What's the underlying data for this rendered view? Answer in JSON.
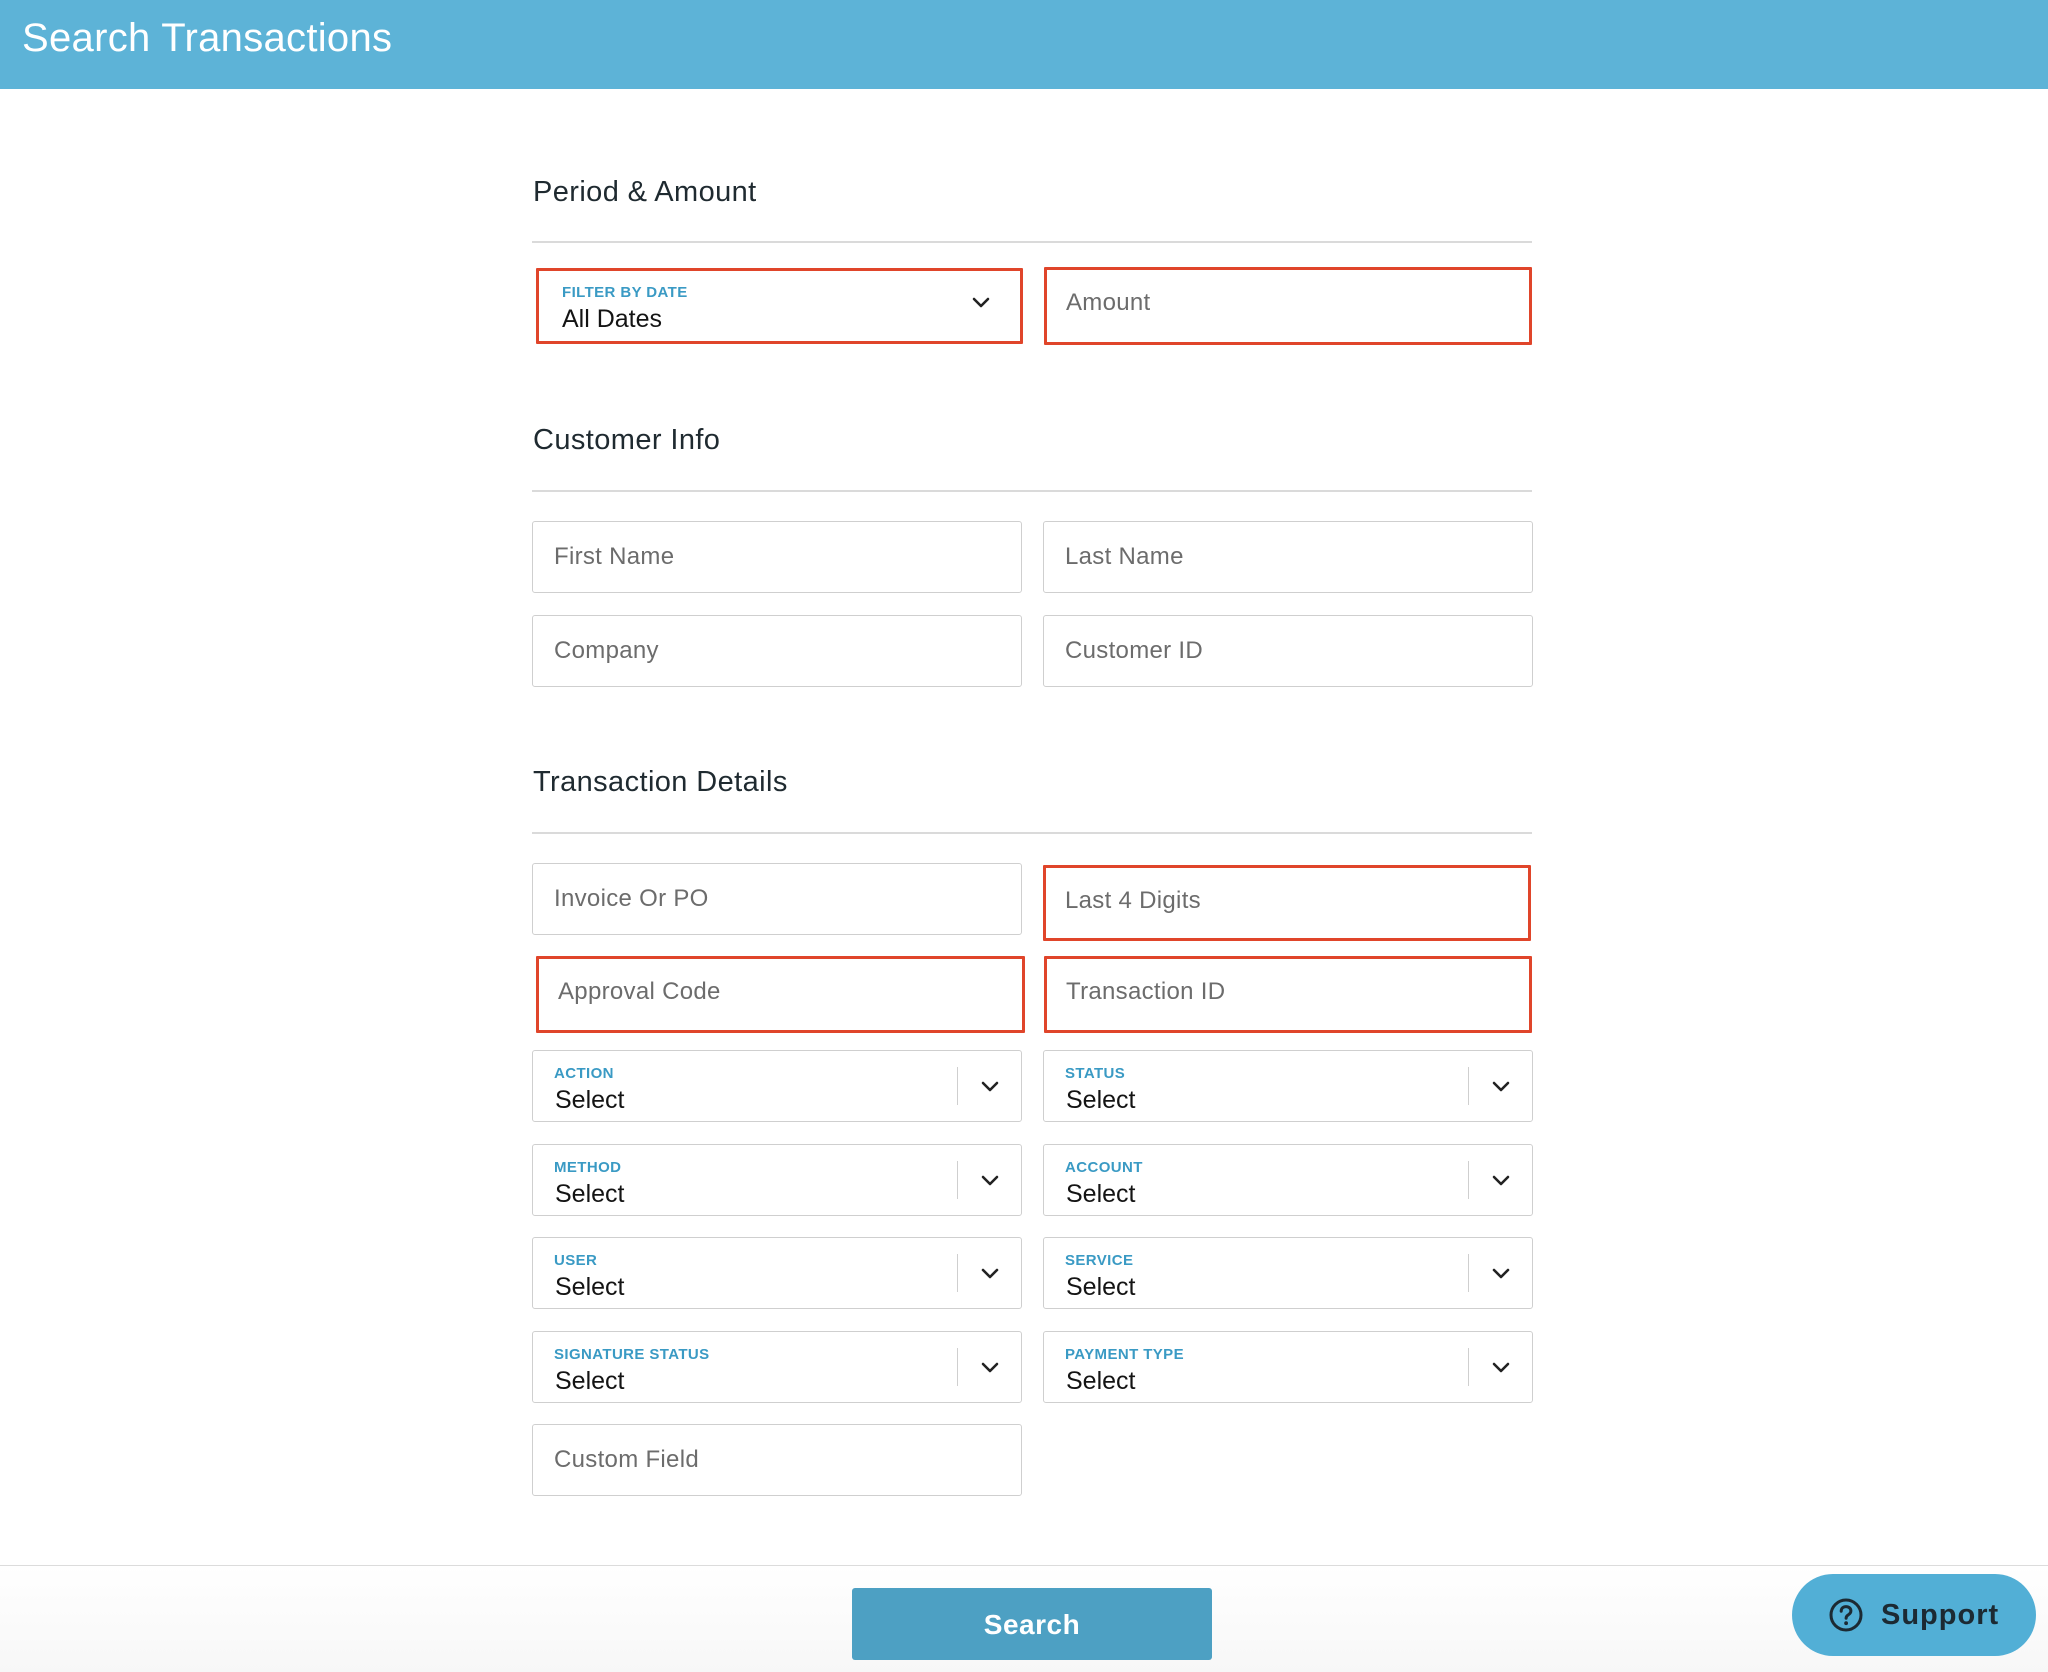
{
  "header": {
    "title": "Search Transactions"
  },
  "sections": {
    "period": {
      "title": "Period & Amount",
      "filter_by_date": {
        "label": "FILTER BY DATE",
        "value": "All Dates"
      },
      "amount_placeholder": "Amount"
    },
    "customer": {
      "title": "Customer Info",
      "first_name_placeholder": "First Name",
      "last_name_placeholder": "Last Name",
      "company_placeholder": "Company",
      "customer_id_placeholder": "Customer ID"
    },
    "transaction": {
      "title": "Transaction Details",
      "invoice_placeholder": "Invoice Or PO",
      "last4_placeholder": "Last 4 Digits",
      "approval_placeholder": "Approval Code",
      "transaction_id_placeholder": "Transaction ID",
      "action": {
        "label": "ACTION",
        "value": "Select"
      },
      "status": {
        "label": "STATUS",
        "value": "Select"
      },
      "method": {
        "label": "METHOD",
        "value": "Select"
      },
      "account": {
        "label": "ACCOUNT",
        "value": "Select"
      },
      "user": {
        "label": "USER",
        "value": "Select"
      },
      "service": {
        "label": "SERVICE",
        "value": "Select"
      },
      "signature_status": {
        "label": "SIGNATURE STATUS",
        "value": "Select"
      },
      "payment_type": {
        "label": "PAYMENT TYPE",
        "value": "Select"
      },
      "custom_field_placeholder": "Custom Field"
    }
  },
  "footer": {
    "search_label": "Search",
    "support_label": "Support"
  },
  "colors": {
    "header_bg": "#5db3d7",
    "highlight_border": "#e0452a",
    "label_blue": "#3a9ac4",
    "search_button": "#4da0c3",
    "support_button": "#52afd6"
  },
  "icons": {
    "dropdown": "chevron-down-icon",
    "support": "question-circle-icon"
  }
}
